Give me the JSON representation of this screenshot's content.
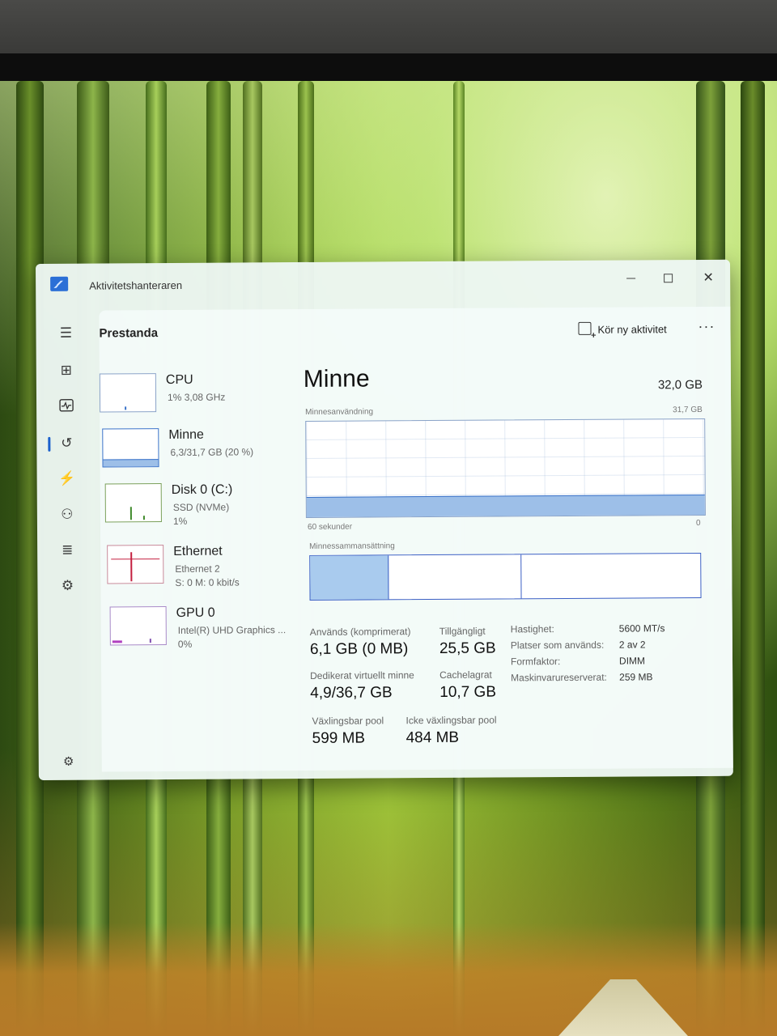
{
  "window": {
    "title": "Aktivitetshanteraren",
    "controls": {
      "minimize": "—",
      "maximize": "☐",
      "close": "✕"
    }
  },
  "sidebar": {
    "items": [
      {
        "name": "menu",
        "icon": "hamburger-icon",
        "glyph": "☰"
      },
      {
        "name": "processes",
        "icon": "processes-icon",
        "glyph": "⊞"
      },
      {
        "name": "performance",
        "icon": "performance-icon",
        "glyph": "〰",
        "active": true
      },
      {
        "name": "app-history",
        "icon": "history-icon",
        "glyph": "↺"
      },
      {
        "name": "startup",
        "icon": "startup-icon",
        "glyph": "⚡"
      },
      {
        "name": "users",
        "icon": "users-icon",
        "glyph": "⚇"
      },
      {
        "name": "details",
        "icon": "details-icon",
        "glyph": "≣"
      },
      {
        "name": "services",
        "icon": "services-icon",
        "glyph": "⚙"
      }
    ],
    "settings_glyph": "⚙"
  },
  "header": {
    "title": "Prestanda",
    "run_task": "Kör ny aktivitet",
    "more": "···"
  },
  "resources": [
    {
      "name": "CPU",
      "sub": "1% 3,08 GHz",
      "sub2": ""
    },
    {
      "name": "Minne",
      "sub": "6,3/31,7 GB (20 %)",
      "sub2": ""
    },
    {
      "name": "Disk 0 (C:)",
      "sub": "SSD (NVMe)",
      "sub2": "1%"
    },
    {
      "name": "Ethernet",
      "sub": "Ethernet 2",
      "sub2": "S: 0 M: 0 kbit/s"
    },
    {
      "name": "GPU 0",
      "sub": "Intel(R) UHD Graphics ...",
      "sub2": "0%"
    }
  ],
  "memory": {
    "title": "Minne",
    "total": "32,0 GB",
    "usage_label": "Minnesanvändning",
    "usage_max": "31,7 GB",
    "usage_fraction": 0.2,
    "time_label": "60 sekunder",
    "time_end": "0",
    "composition_label": "Minnessammansättning",
    "composition_fractions": [
      0.2,
      0.34,
      0.46
    ],
    "stats": {
      "used_label": "Används (komprimerat)",
      "used_value": "6,1 GB (0 MB)",
      "available_label": "Tillgängligt",
      "available_value": "25,5 GB",
      "committed_label": "Dedikerat virtuellt minne",
      "committed_value": "4,9/36,7 GB",
      "cached_label": "Cachelagrat",
      "cached_value": "10,7 GB",
      "paged_label": "Växlingsbar pool",
      "paged_value": "599 MB",
      "nonpaged_label": "Icke växlingsbar pool",
      "nonpaged_value": "484 MB"
    },
    "details": [
      {
        "k": "Hastighet:",
        "v": "5600 MT/s"
      },
      {
        "k": "Platser som används:",
        "v": "2 av 2"
      },
      {
        "k": "Formfaktor:",
        "v": "DIMM"
      },
      {
        "k": "Maskinvarureserverat:",
        "v": "259 MB"
      }
    ]
  }
}
